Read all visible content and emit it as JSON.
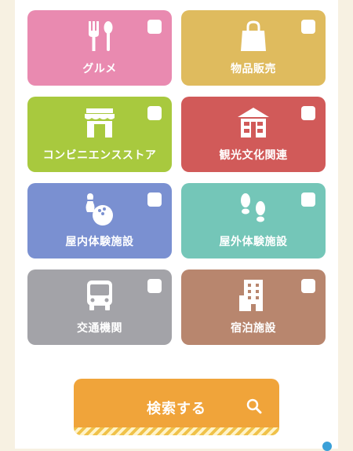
{
  "categories": [
    {
      "label": "グルメ",
      "icon": "fork-spoon-icon",
      "color": "#e98ab0"
    },
    {
      "label": "物品販売",
      "icon": "shopping-bag-icon",
      "color": "#dfbb5e"
    },
    {
      "label": "コンビニエンスストア",
      "icon": "store-icon",
      "color": "#a8c93e"
    },
    {
      "label": "観光文化関連",
      "icon": "building-icon",
      "color": "#d15a59"
    },
    {
      "label": "屋内体験施設",
      "icon": "bowling-icon",
      "color": "#7a90d1"
    },
    {
      "label": "屋外体験施設",
      "icon": "footprints-icon",
      "color": "#74c6b8"
    },
    {
      "label": "交通機関",
      "icon": "bus-icon",
      "color": "#a3a3a8"
    },
    {
      "label": "宿泊施設",
      "icon": "hotel-icon",
      "color": "#b8866e"
    }
  ],
  "search": {
    "label": "検索する",
    "icon": "search-icon",
    "color": "#f0a43a"
  }
}
